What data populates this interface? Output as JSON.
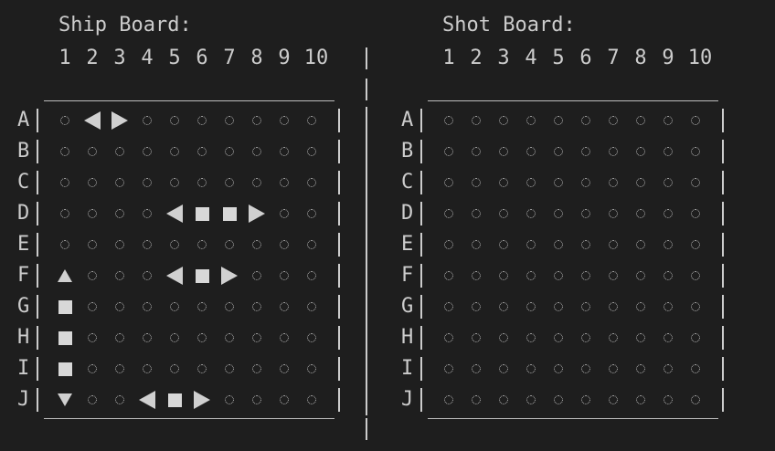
{
  "ship_board": {
    "title": "Ship Board:",
    "columns": [
      "1",
      "2",
      "3",
      "4",
      "5",
      "6",
      "7",
      "8",
      "9",
      "10"
    ],
    "rows": [
      {
        "label": "A",
        "cells": [
          "empty",
          "left",
          "right",
          "empty",
          "empty",
          "empty",
          "empty",
          "empty",
          "empty",
          "empty"
        ]
      },
      {
        "label": "B",
        "cells": [
          "empty",
          "empty",
          "empty",
          "empty",
          "empty",
          "empty",
          "empty",
          "empty",
          "empty",
          "empty"
        ]
      },
      {
        "label": "C",
        "cells": [
          "empty",
          "empty",
          "empty",
          "empty",
          "empty",
          "empty",
          "empty",
          "empty",
          "empty",
          "empty"
        ]
      },
      {
        "label": "D",
        "cells": [
          "empty",
          "empty",
          "empty",
          "empty",
          "left",
          "square",
          "square",
          "right",
          "empty",
          "empty"
        ]
      },
      {
        "label": "E",
        "cells": [
          "empty",
          "empty",
          "empty",
          "empty",
          "empty",
          "empty",
          "empty",
          "empty",
          "empty",
          "empty"
        ]
      },
      {
        "label": "F",
        "cells": [
          "up",
          "empty",
          "empty",
          "empty",
          "left",
          "square",
          "right",
          "empty",
          "empty",
          "empty"
        ]
      },
      {
        "label": "G",
        "cells": [
          "square",
          "empty",
          "empty",
          "empty",
          "empty",
          "empty",
          "empty",
          "empty",
          "empty",
          "empty"
        ]
      },
      {
        "label": "H",
        "cells": [
          "square",
          "empty",
          "empty",
          "empty",
          "empty",
          "empty",
          "empty",
          "empty",
          "empty",
          "empty"
        ]
      },
      {
        "label": "I",
        "cells": [
          "square",
          "empty",
          "empty",
          "empty",
          "empty",
          "empty",
          "empty",
          "empty",
          "empty",
          "empty"
        ]
      },
      {
        "label": "J",
        "cells": [
          "down",
          "empty",
          "empty",
          "left",
          "square",
          "right",
          "empty",
          "empty",
          "empty",
          "empty"
        ]
      }
    ]
  },
  "shot_board": {
    "title": "Shot Board:",
    "columns": [
      "1",
      "2",
      "3",
      "4",
      "5",
      "6",
      "7",
      "8",
      "9",
      "10"
    ],
    "rows": [
      {
        "label": "A",
        "cells": [
          "empty",
          "empty",
          "empty",
          "empty",
          "empty",
          "empty",
          "empty",
          "empty",
          "empty",
          "empty"
        ]
      },
      {
        "label": "B",
        "cells": [
          "empty",
          "empty",
          "empty",
          "empty",
          "empty",
          "empty",
          "empty",
          "empty",
          "empty",
          "empty"
        ]
      },
      {
        "label": "C",
        "cells": [
          "empty",
          "empty",
          "empty",
          "empty",
          "empty",
          "empty",
          "empty",
          "empty",
          "empty",
          "empty"
        ]
      },
      {
        "label": "D",
        "cells": [
          "empty",
          "empty",
          "empty",
          "empty",
          "empty",
          "empty",
          "empty",
          "empty",
          "empty",
          "empty"
        ]
      },
      {
        "label": "E",
        "cells": [
          "empty",
          "empty",
          "empty",
          "empty",
          "empty",
          "empty",
          "empty",
          "empty",
          "empty",
          "empty"
        ]
      },
      {
        "label": "F",
        "cells": [
          "empty",
          "empty",
          "empty",
          "empty",
          "empty",
          "empty",
          "empty",
          "empty",
          "empty",
          "empty"
        ]
      },
      {
        "label": "G",
        "cells": [
          "empty",
          "empty",
          "empty",
          "empty",
          "empty",
          "empty",
          "empty",
          "empty",
          "empty",
          "empty"
        ]
      },
      {
        "label": "H",
        "cells": [
          "empty",
          "empty",
          "empty",
          "empty",
          "empty",
          "empty",
          "empty",
          "empty",
          "empty",
          "empty"
        ]
      },
      {
        "label": "I",
        "cells": [
          "empty",
          "empty",
          "empty",
          "empty",
          "empty",
          "empty",
          "empty",
          "empty",
          "empty",
          "empty"
        ]
      },
      {
        "label": "J",
        "cells": [
          "empty",
          "empty",
          "empty",
          "empty",
          "empty",
          "empty",
          "empty",
          "empty",
          "empty",
          "empty"
        ]
      }
    ]
  },
  "colors": {
    "background": "#1e1e1e",
    "text": "#cccccc"
  }
}
